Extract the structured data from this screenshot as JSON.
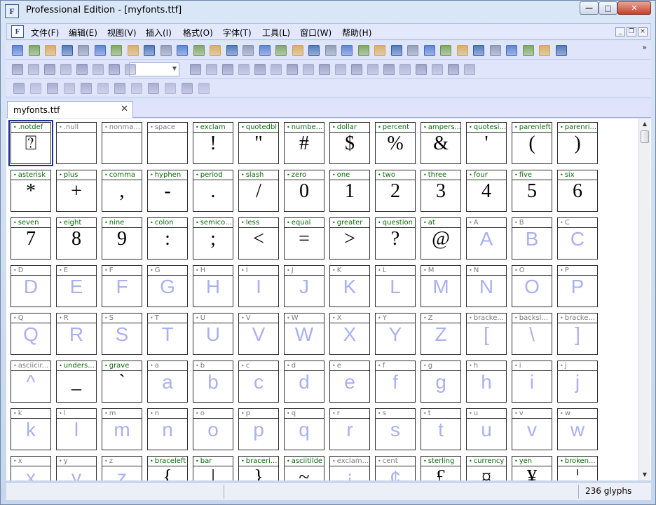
{
  "window": {
    "title": "Professional Edition - [myfonts.ttf]",
    "logo": "F"
  },
  "menu": [
    "文件(F)",
    "编辑(E)",
    "视图(V)",
    "插入(I)",
    "格式(O)",
    "字体(T)",
    "工具(L)",
    "窗口(W)",
    "帮助(H)"
  ],
  "tab": {
    "label": "myfonts.ttf"
  },
  "status": {
    "glyph_count": "236 glyphs"
  },
  "colors": {
    "defined_name": "#0a6b0a",
    "undefined_glyph": "#aab0f0",
    "selection": "#1b2f9a",
    "toolbar_bg": "#e1e5fc"
  },
  "glyphs": [
    {
      "name": ".notdef",
      "char": "⍰",
      "defined": true,
      "selected": true
    },
    {
      "name": ".null",
      "char": "",
      "defined": false
    },
    {
      "name": "nonma...",
      "char": "",
      "defined": false
    },
    {
      "name": "space",
      "char": "",
      "defined": false
    },
    {
      "name": "exclam",
      "char": "!",
      "defined": true
    },
    {
      "name": "quotedbl",
      "char": "\"",
      "defined": true
    },
    {
      "name": "numbe...",
      "char": "#",
      "defined": true
    },
    {
      "name": "dollar",
      "char": "$",
      "defined": true
    },
    {
      "name": "percent",
      "char": "%",
      "defined": true
    },
    {
      "name": "ampers...",
      "char": "&",
      "defined": true
    },
    {
      "name": "quotesi...",
      "char": "'",
      "defined": true
    },
    {
      "name": "parenleft",
      "char": "(",
      "defined": true
    },
    {
      "name": "parenri...",
      "char": ")",
      "defined": true
    },
    {
      "name": "asterisk",
      "char": "*",
      "defined": true
    },
    {
      "name": "plus",
      "char": "+",
      "defined": true
    },
    {
      "name": "comma",
      "char": ",",
      "defined": true
    },
    {
      "name": "hyphen",
      "char": "-",
      "defined": true
    },
    {
      "name": "period",
      "char": ".",
      "defined": true
    },
    {
      "name": "slash",
      "char": "/",
      "defined": true
    },
    {
      "name": "zero",
      "char": "0",
      "defined": true
    },
    {
      "name": "one",
      "char": "1",
      "defined": true
    },
    {
      "name": "two",
      "char": "2",
      "defined": true
    },
    {
      "name": "three",
      "char": "3",
      "defined": true
    },
    {
      "name": "four",
      "char": "4",
      "defined": true
    },
    {
      "name": "five",
      "char": "5",
      "defined": true
    },
    {
      "name": "six",
      "char": "6",
      "defined": true
    },
    {
      "name": "seven",
      "char": "7",
      "defined": true
    },
    {
      "name": "eight",
      "char": "8",
      "defined": true
    },
    {
      "name": "nine",
      "char": "9",
      "defined": true
    },
    {
      "name": "colon",
      "char": ":",
      "defined": true
    },
    {
      "name": "semico...",
      "char": ";",
      "defined": true
    },
    {
      "name": "less",
      "char": "<",
      "defined": true
    },
    {
      "name": "equal",
      "char": "=",
      "defined": true
    },
    {
      "name": "greater",
      "char": ">",
      "defined": true
    },
    {
      "name": "question",
      "char": "?",
      "defined": true
    },
    {
      "name": "at",
      "char": "@",
      "defined": true
    },
    {
      "name": "A",
      "char": "A",
      "defined": false
    },
    {
      "name": "B",
      "char": "B",
      "defined": false
    },
    {
      "name": "C",
      "char": "C",
      "defined": false
    },
    {
      "name": "D",
      "char": "D",
      "defined": false
    },
    {
      "name": "E",
      "char": "E",
      "defined": false
    },
    {
      "name": "F",
      "char": "F",
      "defined": false
    },
    {
      "name": "G",
      "char": "G",
      "defined": false
    },
    {
      "name": "H",
      "char": "H",
      "defined": false
    },
    {
      "name": "I",
      "char": "I",
      "defined": false
    },
    {
      "name": "J",
      "char": "J",
      "defined": false
    },
    {
      "name": "K",
      "char": "K",
      "defined": false
    },
    {
      "name": "L",
      "char": "L",
      "defined": false
    },
    {
      "name": "M",
      "char": "M",
      "defined": false
    },
    {
      "name": "N",
      "char": "N",
      "defined": false
    },
    {
      "name": "O",
      "char": "O",
      "defined": false
    },
    {
      "name": "P",
      "char": "P",
      "defined": false
    },
    {
      "name": "Q",
      "char": "Q",
      "defined": false
    },
    {
      "name": "R",
      "char": "R",
      "defined": false
    },
    {
      "name": "S",
      "char": "S",
      "defined": false
    },
    {
      "name": "T",
      "char": "T",
      "defined": false
    },
    {
      "name": "U",
      "char": "U",
      "defined": false
    },
    {
      "name": "V",
      "char": "V",
      "defined": false
    },
    {
      "name": "W",
      "char": "W",
      "defined": false
    },
    {
      "name": "X",
      "char": "X",
      "defined": false
    },
    {
      "name": "Y",
      "char": "Y",
      "defined": false
    },
    {
      "name": "Z",
      "char": "Z",
      "defined": false
    },
    {
      "name": "bracke...",
      "char": "[",
      "defined": false
    },
    {
      "name": "backsl...",
      "char": "\\",
      "defined": false
    },
    {
      "name": "bracke...",
      "char": "]",
      "defined": false
    },
    {
      "name": "asciicir...",
      "char": "^",
      "defined": false
    },
    {
      "name": "unders...",
      "char": "_",
      "defined": true
    },
    {
      "name": "grave",
      "char": "`",
      "defined": true
    },
    {
      "name": "a",
      "char": "a",
      "defined": false
    },
    {
      "name": "b",
      "char": "b",
      "defined": false
    },
    {
      "name": "c",
      "char": "c",
      "defined": false
    },
    {
      "name": "d",
      "char": "d",
      "defined": false
    },
    {
      "name": "e",
      "char": "e",
      "defined": false
    },
    {
      "name": "f",
      "char": "f",
      "defined": false
    },
    {
      "name": "g",
      "char": "g",
      "defined": false
    },
    {
      "name": "h",
      "char": "h",
      "defined": false
    },
    {
      "name": "i",
      "char": "i",
      "defined": false
    },
    {
      "name": "j",
      "char": "j",
      "defined": false
    },
    {
      "name": "k",
      "char": "k",
      "defined": false
    },
    {
      "name": "l",
      "char": "l",
      "defined": false
    },
    {
      "name": "m",
      "char": "m",
      "defined": false
    },
    {
      "name": "n",
      "char": "n",
      "defined": false
    },
    {
      "name": "o",
      "char": "o",
      "defined": false
    },
    {
      "name": "p",
      "char": "p",
      "defined": false
    },
    {
      "name": "q",
      "char": "q",
      "defined": false
    },
    {
      "name": "r",
      "char": "r",
      "defined": false
    },
    {
      "name": "s",
      "char": "s",
      "defined": false
    },
    {
      "name": "t",
      "char": "t",
      "defined": false
    },
    {
      "name": "u",
      "char": "u",
      "defined": false
    },
    {
      "name": "v",
      "char": "v",
      "defined": false
    },
    {
      "name": "w",
      "char": "w",
      "defined": false
    },
    {
      "name": "x",
      "char": "x",
      "defined": false
    },
    {
      "name": "y",
      "char": "y",
      "defined": false
    },
    {
      "name": "z",
      "char": "z",
      "defined": false
    },
    {
      "name": "braceleft",
      "char": "{",
      "defined": true
    },
    {
      "name": "bar",
      "char": "|",
      "defined": true
    },
    {
      "name": "braceri...",
      "char": "}",
      "defined": true
    },
    {
      "name": "asciitilde",
      "char": "~",
      "defined": true
    },
    {
      "name": "exclam...",
      "char": "¡",
      "defined": false
    },
    {
      "name": "cent",
      "char": "¢",
      "defined": false
    },
    {
      "name": "sterling",
      "char": "£",
      "defined": true
    },
    {
      "name": "currency",
      "char": "¤",
      "defined": true
    },
    {
      "name": "yen",
      "char": "¥",
      "defined": true
    },
    {
      "name": "broken...",
      "char": "¦",
      "defined": true
    }
  ]
}
